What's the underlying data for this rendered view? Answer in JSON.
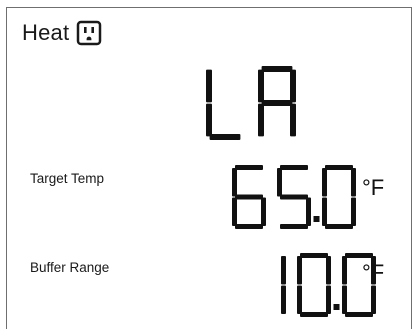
{
  "mode": {
    "label": "Heat",
    "icon": "power-outlet-icon"
  },
  "status_display": {
    "text": "LA"
  },
  "target_temp": {
    "label": "Target Temp",
    "value": "65.0",
    "unit": "°F"
  },
  "buffer_range": {
    "label": "Buffer Range",
    "value": "10.0",
    "unit": "°F"
  },
  "colors": {
    "segment": "#111111",
    "border": "#6f6f6f",
    "background": "#ffffff"
  }
}
